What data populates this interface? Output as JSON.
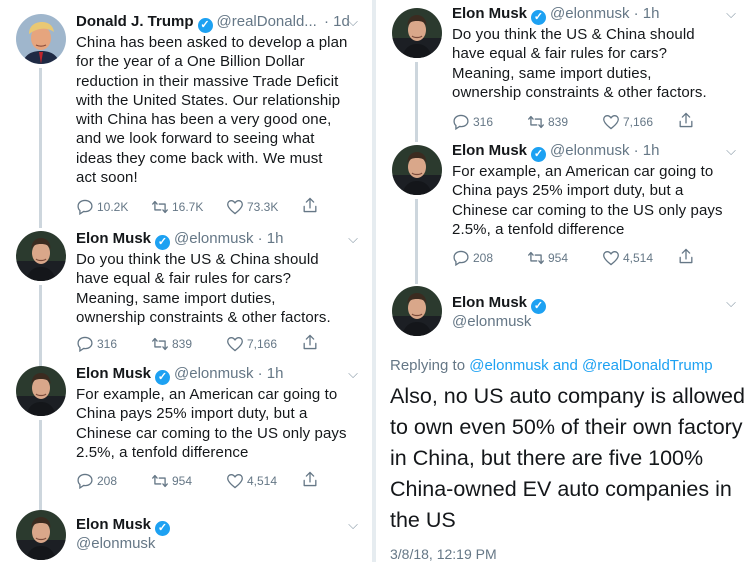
{
  "left": {
    "trump": {
      "name": "Donald J. Trump",
      "handle": "@realDonald...",
      "time": "· 1d",
      "lines": [
        "China has been asked to develop a plan",
        "for the year of a One Billion Dollar",
        "reduction in their massive Trade Deficit",
        "with the United States. Our relationship",
        "with China has been a very good one,",
        "and we look forward to seeing what",
        "ideas they come back with. We must",
        "act soon!"
      ],
      "replies": "10.2K",
      "retweets": "16.7K",
      "likes": "73.3K"
    },
    "musk1": {
      "name": "Elon Musk",
      "handle": "@elonmusk · 1h",
      "lines": [
        "Do you think the US & China should",
        "have equal & fair rules for cars?",
        "Meaning, same import duties,",
        "ownership constraints & other factors."
      ],
      "replies": "316",
      "retweets": "839",
      "likes": "7,166"
    },
    "musk2": {
      "name": "Elon Musk",
      "handle": "@elonmusk · 1h",
      "lines": [
        "For example, an American car going to",
        "China pays 25% import duty, but a",
        "Chinese car coming to the US only pays",
        "2.5%, a tenfold difference"
      ],
      "replies": "208",
      "retweets": "954",
      "likes": "4,514"
    },
    "musk3": {
      "name": "Elon Musk",
      "handle": "@elonmusk"
    }
  },
  "right": {
    "musk1": {
      "name": "Elon Musk",
      "handle": "@elonmusk · 1h",
      "lines": [
        "Do you think the US & China should",
        "have equal & fair rules for cars?",
        "Meaning, same import duties,",
        "ownership constraints & other factors."
      ],
      "replies": "316",
      "retweets": "839",
      "likes": "7,166"
    },
    "musk2": {
      "name": "Elon Musk",
      "handle": "@elonmusk · 1h",
      "lines": [
        "For example, an American car going to",
        "China pays 25% import duty, but a",
        "Chinese car coming to the US only pays",
        "2.5%, a tenfold difference"
      ],
      "replies": "208",
      "retweets": "954",
      "likes": "4,514"
    },
    "musk3": {
      "name": "Elon Musk",
      "handle": "@elonmusk",
      "replying_prefix": "Replying to",
      "replying_user1": "@elonmusk",
      "replying_and": "and",
      "replying_user2": "@realDonaldTrump",
      "lines": [
        "Also, no US auto company is allowed",
        "to own even 50% of their own factory",
        "in China, but there are five 100%",
        "China-owned EV auto companies in",
        "the US"
      ],
      "date": "3/8/18, 12:19 PM"
    }
  },
  "icons": {
    "verified": "verified-check-icon",
    "chevron": "chevron-down-icon"
  },
  "colors": {
    "twitter_blue": "#1da1f2",
    "gray": "#657786",
    "thread_line": "#cdd6dd"
  }
}
